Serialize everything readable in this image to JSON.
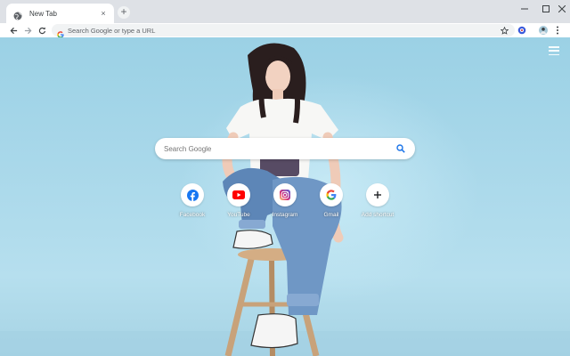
{
  "browser": {
    "tab": {
      "title": "New Tab",
      "close_glyph": "×"
    },
    "new_tab_glyph": "+",
    "window_controls": {
      "minimize_icon": "minimize-icon",
      "maximize_icon": "maximize-icon",
      "close_icon": "close-icon"
    }
  },
  "toolbar": {
    "omnibox_placeholder": "Search Google or type a URL",
    "icons": [
      "back-icon",
      "forward-icon",
      "reload-icon",
      "star-icon",
      "extension-icon",
      "profile-avatar",
      "kebab-menu-icon"
    ]
  },
  "ntp": {
    "search_placeholder": "Search Google",
    "shortcuts": [
      {
        "label": "Facebook",
        "icon": "facebook-icon",
        "color": "#1877f2"
      },
      {
        "label": "YouTube",
        "icon": "youtube-icon",
        "color": "#ff0000"
      },
      {
        "label": "Instagram",
        "icon": "instagram-icon",
        "color": "#c13584"
      },
      {
        "label": "Gmail",
        "icon": "google-icon",
        "color": "#4285f4"
      },
      {
        "label": "Add shortcut",
        "icon": "plus-icon",
        "color": "#202124"
      }
    ],
    "background_color": "#a9d8ea"
  }
}
